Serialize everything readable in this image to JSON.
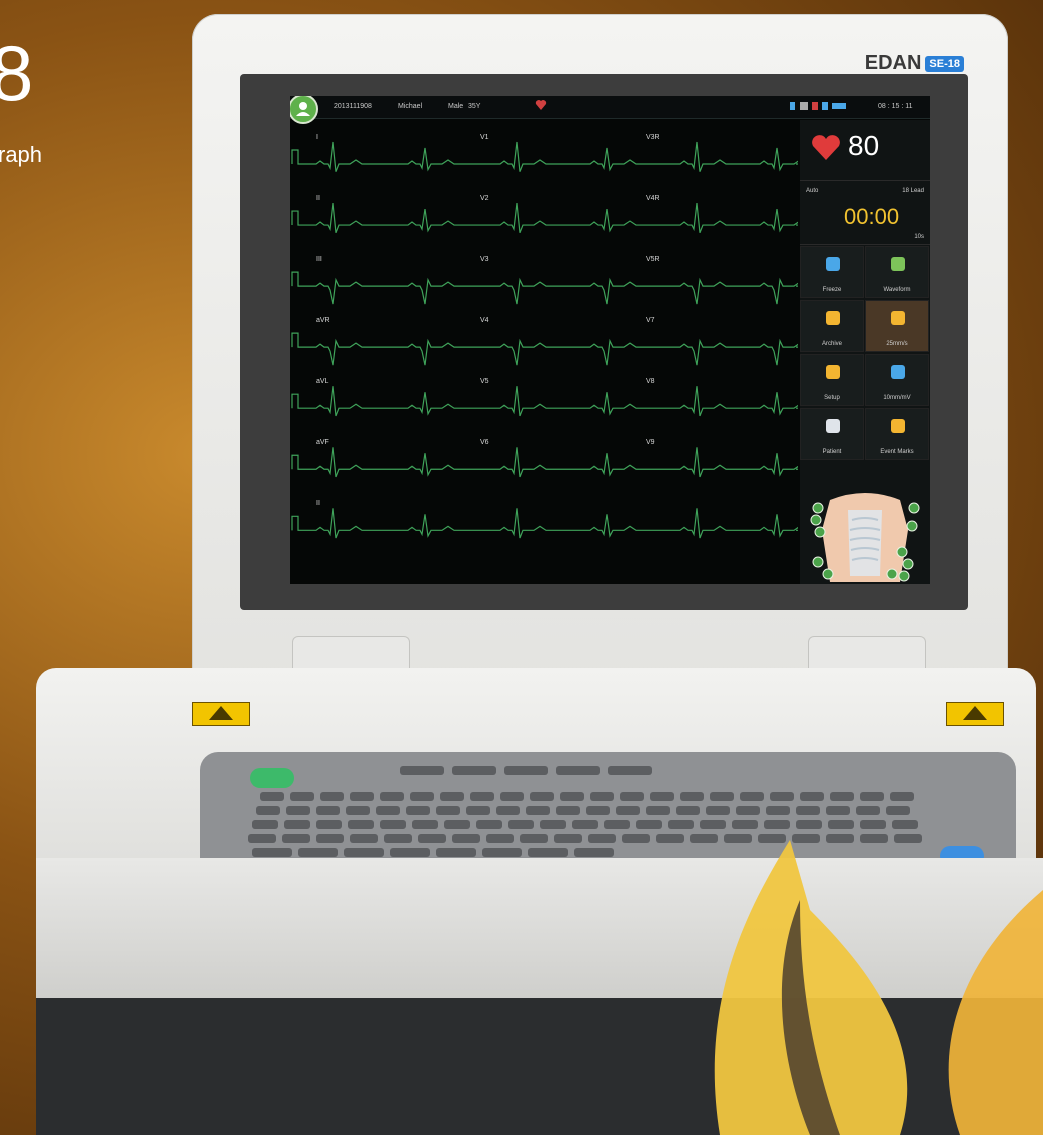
{
  "promo": {
    "title_partial": "8",
    "subtitle_partial": "raph"
  },
  "device": {
    "brand": "EDAN",
    "model": "SE-18"
  },
  "status_bar": {
    "id_text": "2013111908",
    "patient_name": "Michael",
    "sex": "Male",
    "age": "35Y",
    "time": "08 : 15 : 11"
  },
  "leads_left": [
    "I",
    "II",
    "III",
    "aVR",
    "aVL",
    "aVF",
    "II"
  ],
  "leads_middle": [
    "V1",
    "V2",
    "V3",
    "V4",
    "V5",
    "V6"
  ],
  "leads_right": [
    "V3R",
    "V4R",
    "V5R",
    "V7",
    "V8",
    "V9"
  ],
  "heart_rate": {
    "value": "80"
  },
  "timer": {
    "mode": "Auto",
    "label": "18 Lead",
    "value": "00:00",
    "sub": "10s"
  },
  "menu": [
    {
      "label": "Freeze",
      "icon": "snowflake-icon",
      "color": "#4aa7e8"
    },
    {
      "label": "Waveform",
      "icon": "bars-icon",
      "color": "#7dc35a"
    },
    {
      "label": "Archive",
      "icon": "folder-icon",
      "color": "#f3b531"
    },
    {
      "label": "25mm/s",
      "icon": "speed-icon",
      "color": "#f3b531"
    },
    {
      "label": "Setup",
      "icon": "gear-icon",
      "color": "#f3b531"
    },
    {
      "label": "10mm/mV",
      "icon": "gain-icon",
      "color": "#4aa7e8"
    },
    {
      "label": "Patient",
      "icon": "patient-form-icon",
      "color": "#dfe4ea"
    },
    {
      "label": "Event Marks",
      "icon": "pin-icon",
      "color": "#f3b531"
    }
  ],
  "colors": {
    "ecg_trace": "#3fa35a",
    "heart": "#e03b3b",
    "timer": "#f1c230",
    "accent": "#2a7fd6"
  }
}
